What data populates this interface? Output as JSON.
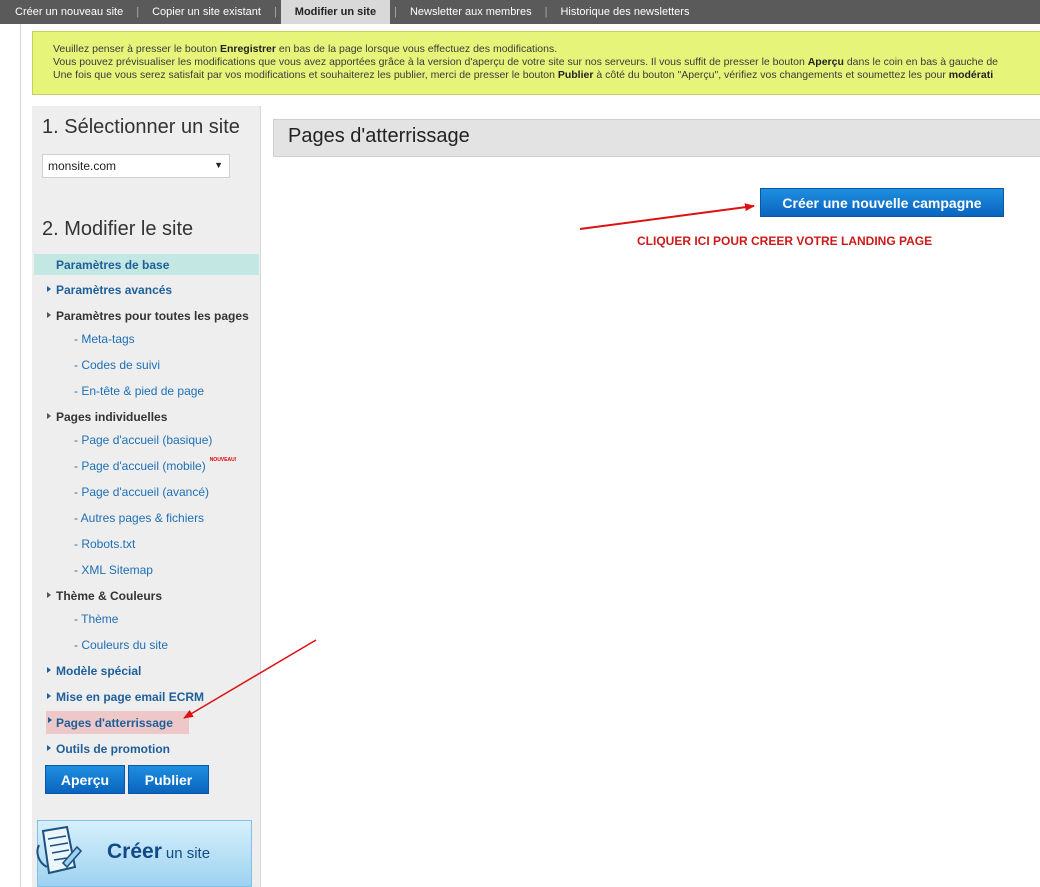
{
  "topnav": {
    "tabs": [
      {
        "label": "Créer un nouveau site"
      },
      {
        "label": "Copier un site existant"
      },
      {
        "label": "Modifier un site"
      },
      {
        "label": "Newsletter aux membres"
      },
      {
        "label": "Historique des newsletters"
      }
    ],
    "separator": "|"
  },
  "notice": {
    "line1_a": "Veuillez penser à presser le bouton ",
    "line1_b": "Enregistrer",
    "line1_c": " en bas de la page lorsque vous effectuez des modifications.",
    "line2_a": "Vous pouvez prévisualiser les modifications que vous avez apportées grâce à la version d'aperçu de votre site sur nos serveurs. Il vous suffit de presser le bouton ",
    "line2_b": "Aperçu",
    "line2_c": " dans le coin en bas à gauche de",
    "line3_a": "Une fois que vous serez satisfait par vos modifications et souhaiterez les publier, merci de presser le bouton ",
    "line3_b": "Publier",
    "line3_c": " à côté du bouton \"Aperçu\", vérifiez vos changements et soumettez les pour ",
    "line3_d": "modérati"
  },
  "sidebar": {
    "heading1": "1. Sélectionner un site",
    "site_select_value": "monsite.com",
    "heading2": "2. Modifier le site",
    "items": {
      "base": "Paramètres de base",
      "advanced": "Paramètres avancés",
      "all_pages": "Paramètres pour toutes les pages",
      "meta_tags": "- Meta-tags",
      "tracking": "- Codes de suivi",
      "header_footer": "- En-tête & pied de page",
      "individual_pages": "Pages individuelles",
      "home_basic": "- Page d'accueil (basique)",
      "home_mobile": "- Page d'accueil (mobile)",
      "new_badge": "NOUVEAU!",
      "home_advanced": "- Page d'accueil (avancé)",
      "other_pages": "- Autres pages & fichiers",
      "robots": "- Robots.txt",
      "sitemap": "- XML Sitemap",
      "theme_colors": "Thème & Couleurs",
      "theme": "- Thème",
      "site_colors": "- Couleurs du site",
      "special_model": "Modèle spécial",
      "email_layout": "Mise en page email ECRM",
      "landing_pages": "Pages d'atterrissage",
      "promo_tools": "Outils de promotion"
    },
    "preview_label": "Aperçu",
    "publish_label": "Publier",
    "create_site_big": "Créer",
    "create_site_small": "un site"
  },
  "main": {
    "title": "Pages d'atterrissage",
    "new_campaign_label": "Créer une nouvelle campagne",
    "annotation": "CLIQUER ICI POUR CREER VOTRE LANDING PAGE"
  },
  "colors": {
    "nav_bg": "#5a5a5a",
    "notice_bg": "#e6f57a",
    "link_blue": "#1e5f9a",
    "button_blue": "#0a64be",
    "annotation_red": "#cc1a1a",
    "highlight_pink": "#eec8c8"
  }
}
